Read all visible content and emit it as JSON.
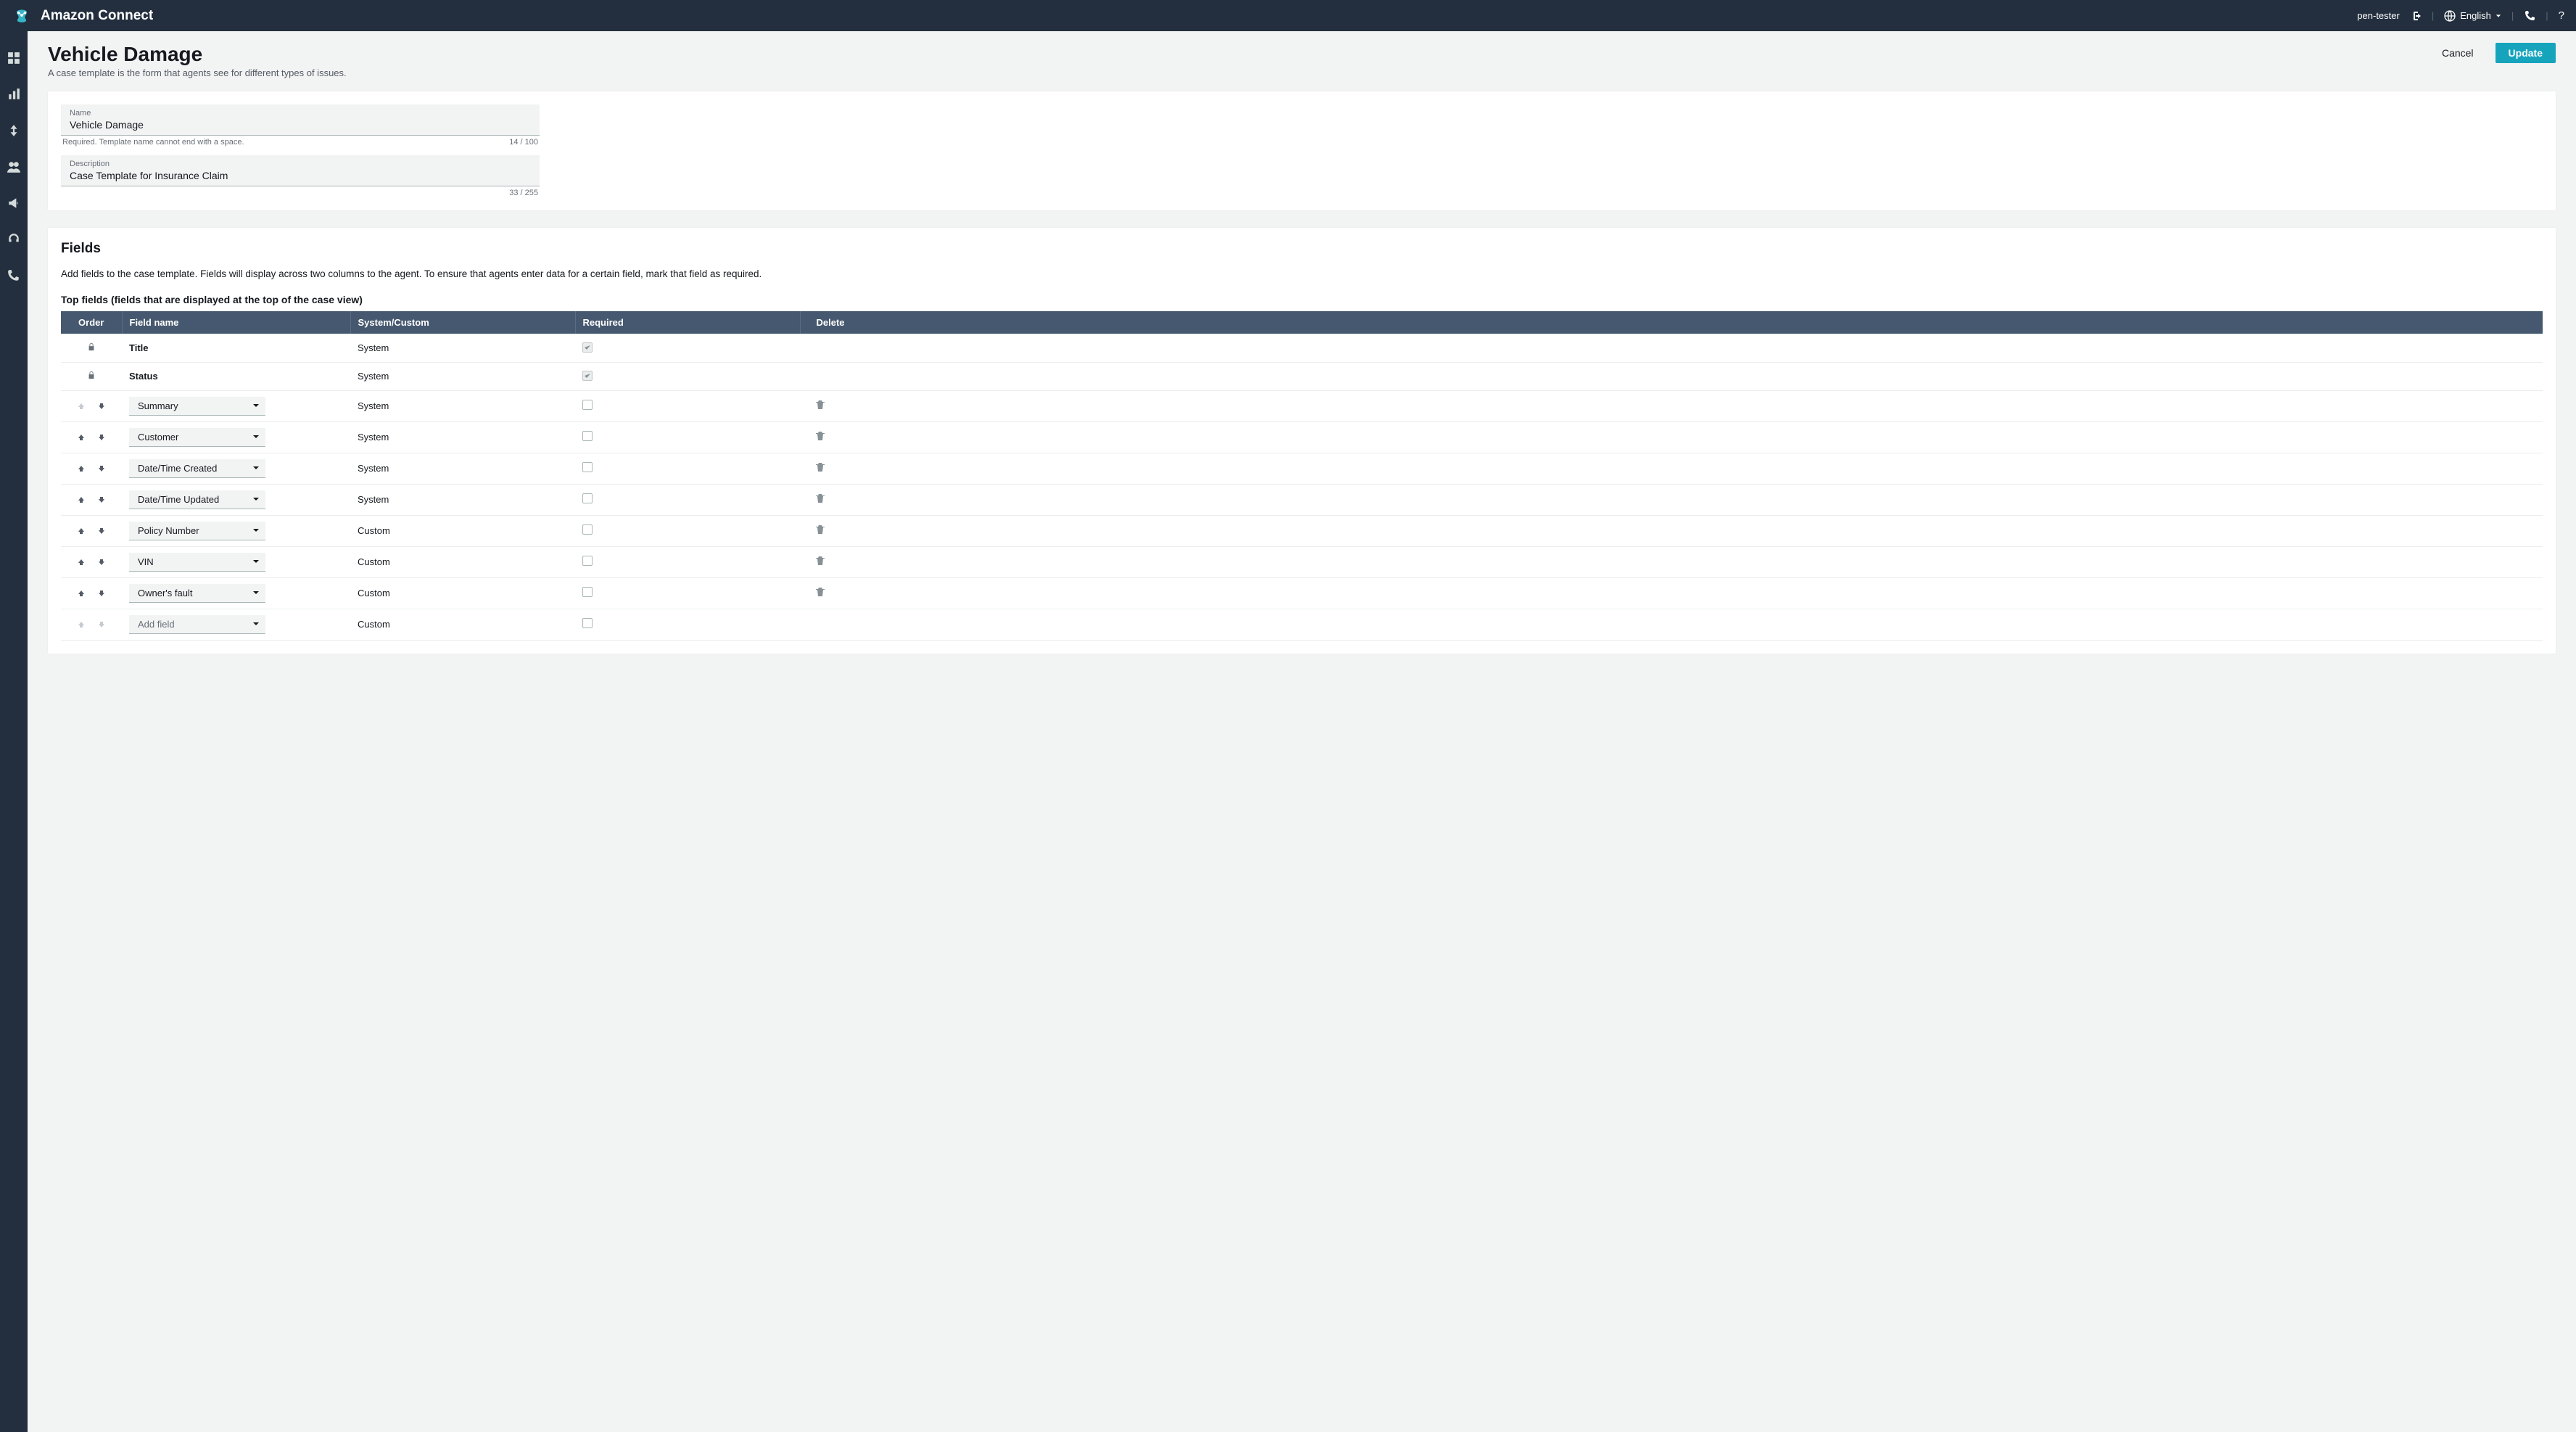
{
  "topbar": {
    "title": "Amazon Connect",
    "user": "pen-tester",
    "language": "English"
  },
  "page": {
    "title": "Vehicle Damage",
    "subtitle": "A case template is the form that agents see for different types of issues.",
    "cancel": "Cancel",
    "update": "Update"
  },
  "form": {
    "name_label": "Name",
    "name_value": "Vehicle Damage",
    "name_help": "Required.  Template name cannot end with a space.",
    "name_count": "14 / 100",
    "desc_label": "Description",
    "desc_value": "Case Template for Insurance Claim",
    "desc_count": "33 / 255"
  },
  "fields": {
    "heading": "Fields",
    "desc": "Add fields to the case template. Fields will display across two columns to the agent. To ensure that agents enter data for a certain field, mark that field as required.",
    "top_label": "Top fields (fields that are displayed at the top of the case view)",
    "columns": {
      "order": "Order",
      "name": "Field name",
      "syscustom": "System/Custom",
      "required": "Required",
      "delete": "Delete"
    },
    "rows": [
      {
        "locked": true,
        "name": "Title",
        "type": "System",
        "required_checked": true,
        "dropdown": false,
        "deletable": false,
        "up_disabled": true,
        "down_disabled": true
      },
      {
        "locked": true,
        "name": "Status",
        "type": "System",
        "required_checked": true,
        "dropdown": false,
        "deletable": false,
        "up_disabled": true,
        "down_disabled": true
      },
      {
        "locked": false,
        "name": "Summary",
        "type": "System",
        "required_checked": false,
        "dropdown": true,
        "deletable": true,
        "up_disabled": true,
        "down_disabled": false
      },
      {
        "locked": false,
        "name": "Customer",
        "type": "System",
        "required_checked": false,
        "dropdown": true,
        "deletable": true,
        "up_disabled": false,
        "down_disabled": false
      },
      {
        "locked": false,
        "name": "Date/Time Created",
        "type": "System",
        "required_checked": false,
        "dropdown": true,
        "deletable": true,
        "up_disabled": false,
        "down_disabled": false
      },
      {
        "locked": false,
        "name": "Date/Time Updated",
        "type": "System",
        "required_checked": false,
        "dropdown": true,
        "deletable": true,
        "up_disabled": false,
        "down_disabled": false
      },
      {
        "locked": false,
        "name": "Policy Number",
        "type": "Custom",
        "required_checked": false,
        "dropdown": true,
        "deletable": true,
        "up_disabled": false,
        "down_disabled": false
      },
      {
        "locked": false,
        "name": "VIN",
        "type": "Custom",
        "required_checked": false,
        "dropdown": true,
        "deletable": true,
        "up_disabled": false,
        "down_disabled": false
      },
      {
        "locked": false,
        "name": "Owner's fault",
        "type": "Custom",
        "required_checked": false,
        "dropdown": true,
        "deletable": true,
        "up_disabled": false,
        "down_disabled": false
      },
      {
        "locked": false,
        "name": "Add field",
        "type": "Custom",
        "required_checked": false,
        "dropdown": true,
        "deletable": false,
        "up_disabled": true,
        "down_disabled": true,
        "placeholder": true
      }
    ]
  }
}
